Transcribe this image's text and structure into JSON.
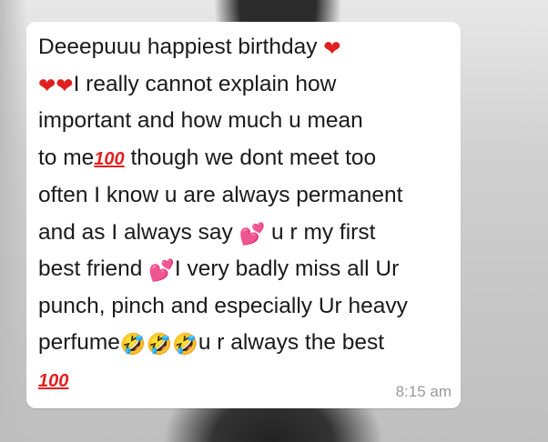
{
  "message": {
    "line1": "Deeepuuu happiest birthday ",
    "line2": "I really cannot explain how",
    "line3": "important and how much u mean",
    "line4a": "to me",
    "line4b": " though we dont meet too",
    "line5": "often I know u are always permanent",
    "line6a": "and as I always say ",
    "line6b": " u r my first",
    "line7a": "best friend ",
    "line7b": "I very badly miss all Ur",
    "line8": "punch, pinch and especially Ur heavy",
    "line9a": "perfume",
    "line9b": "u r always the best",
    "time": "8:15 am"
  },
  "icons": {
    "heart": "❤",
    "hundred": "100",
    "pink_hearts": "💕",
    "laughing": "🤣"
  },
  "colors": {
    "bubble": "#ffffff",
    "text": "#1a1a1a",
    "time": "#9a9a9a",
    "heart": "#e0201f"
  }
}
